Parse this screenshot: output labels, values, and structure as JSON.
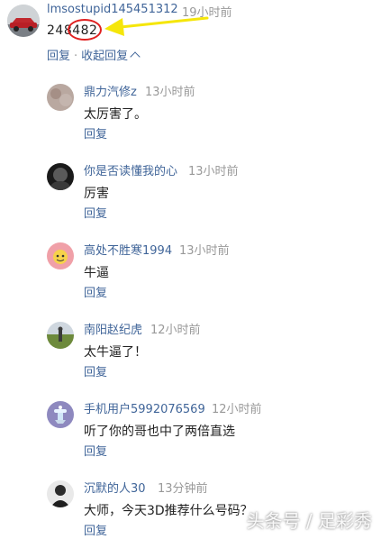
{
  "top_comment": {
    "username": "lmsostupid145451312",
    "time": "19小时前",
    "text_prefix": "248",
    "text_highlight": "482",
    "actions": {
      "reply": "回复",
      "separator": "·",
      "collapse": "收起回复"
    }
  },
  "replies": [
    {
      "username": "鼎力汽修z",
      "time": "13小时前",
      "text": "太厉害了。",
      "reply": "回复",
      "avatar": "avatar-photo-gray"
    },
    {
      "username": "你是否读懂我的心",
      "time": "13小时前",
      "text": "厉害",
      "reply": "回复",
      "avatar": "avatar-photo-dark"
    },
    {
      "username": "高处不胜寒1994",
      "time": "13小时前",
      "text": "牛逼",
      "reply": "回复",
      "avatar": "avatar-cartoon"
    },
    {
      "username": "南阳赵纪虎",
      "time": "12小时前",
      "text": "太牛逼了！",
      "reply": "回复",
      "avatar": "avatar-photo-field"
    },
    {
      "username": "手机用户5992076569",
      "time": "12小时前",
      "text": "听了你的哥也中了两倍直选",
      "reply": "回复",
      "avatar": "avatar-default"
    },
    {
      "username": "沉默的人30",
      "time": "13分钟前",
      "text": "大师，今天3D推荐什么号码？",
      "reply": "回复",
      "avatar": "avatar-photo-person"
    }
  ],
  "watermark": "头条号 / 足彩秀",
  "colors": {
    "link": "#406599",
    "time": "#999999",
    "annotation_red": "#e02020",
    "annotation_yellow": "#f5e60a"
  }
}
